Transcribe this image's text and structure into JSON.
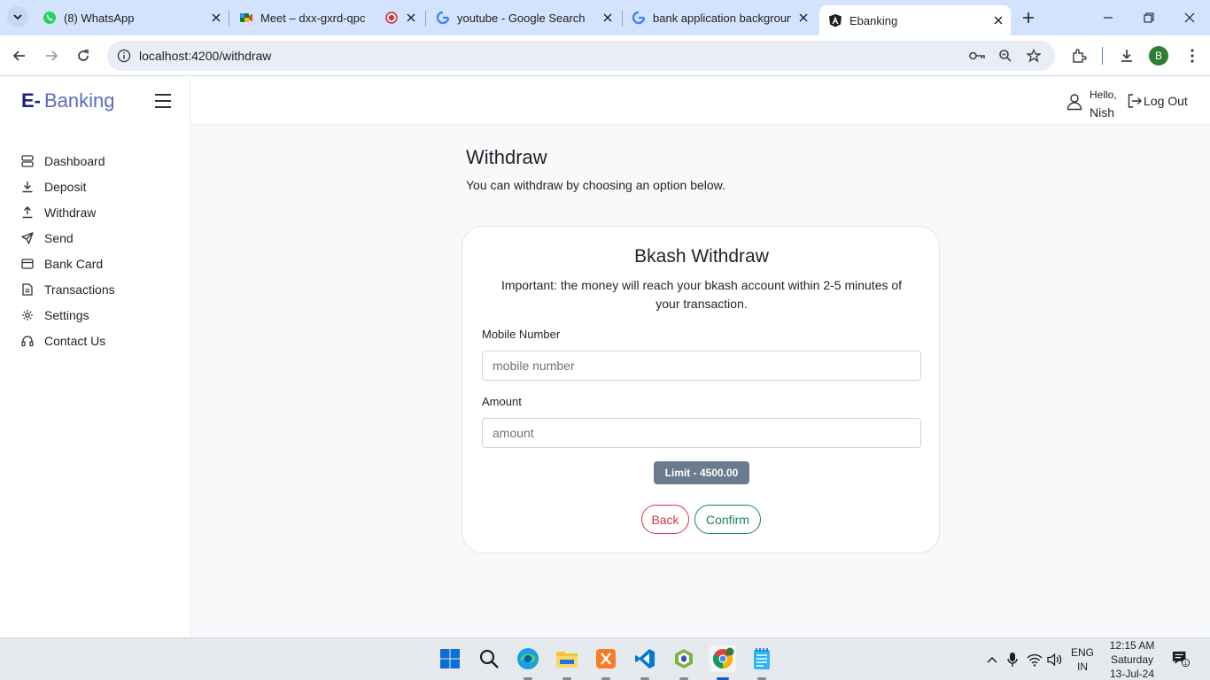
{
  "browser": {
    "tabs": [
      {
        "label": "(8) WhatsApp",
        "icon": "whatsapp-icon"
      },
      {
        "label": "Meet – dxx-gxrd-qpc",
        "icon": "google-meet-icon"
      },
      {
        "label": "youtube - Google Search",
        "icon": "google-icon"
      },
      {
        "label": "bank application backgroun",
        "icon": "google-icon"
      },
      {
        "label": "Ebanking",
        "icon": "angular-icon"
      }
    ],
    "address": "localhost:4200/withdraw"
  },
  "sidebar": {
    "brand_prefix": "E-",
    "brand_name": "Banking",
    "items": [
      {
        "label": "Dashboard",
        "icon": "dashboard-icon"
      },
      {
        "label": "Deposit",
        "icon": "download-icon"
      },
      {
        "label": "Withdraw",
        "icon": "upload-icon"
      },
      {
        "label": "Send",
        "icon": "send-icon"
      },
      {
        "label": "Bank Card",
        "icon": "credit-card-icon"
      },
      {
        "label": "Transactions",
        "icon": "receipt-icon"
      },
      {
        "label": "Settings",
        "icon": "gear-icon"
      },
      {
        "label": "Contact Us",
        "icon": "headset-icon"
      }
    ]
  },
  "header": {
    "greeting": "Hello,",
    "user_name": "Nish",
    "logout_label": "Log Out"
  },
  "page": {
    "title": "Withdraw",
    "subtitle": "You can withdraw by choosing an option below."
  },
  "form": {
    "title": "Bkash Withdraw",
    "note": "Important: the money will reach your bkash account within 2-5 minutes of your transaction.",
    "mobile_label": "Mobile Number",
    "mobile_placeholder": "mobile number",
    "mobile_value": "",
    "amount_label": "Amount",
    "amount_placeholder": "amount",
    "amount_value": "",
    "limit_badge": "Limit - 4500.00",
    "back_label": "Back",
    "confirm_label": "Confirm"
  },
  "taskbar": {
    "lang_line1": "ENG",
    "lang_line2": "IN",
    "time": "12:15 AM",
    "day": "Saturday",
    "date": "13-Jul-24"
  },
  "colors": {
    "accent": "#5c6bc0",
    "danger": "#dc3545",
    "success": "#198754",
    "badge": "#6c7a8d"
  }
}
